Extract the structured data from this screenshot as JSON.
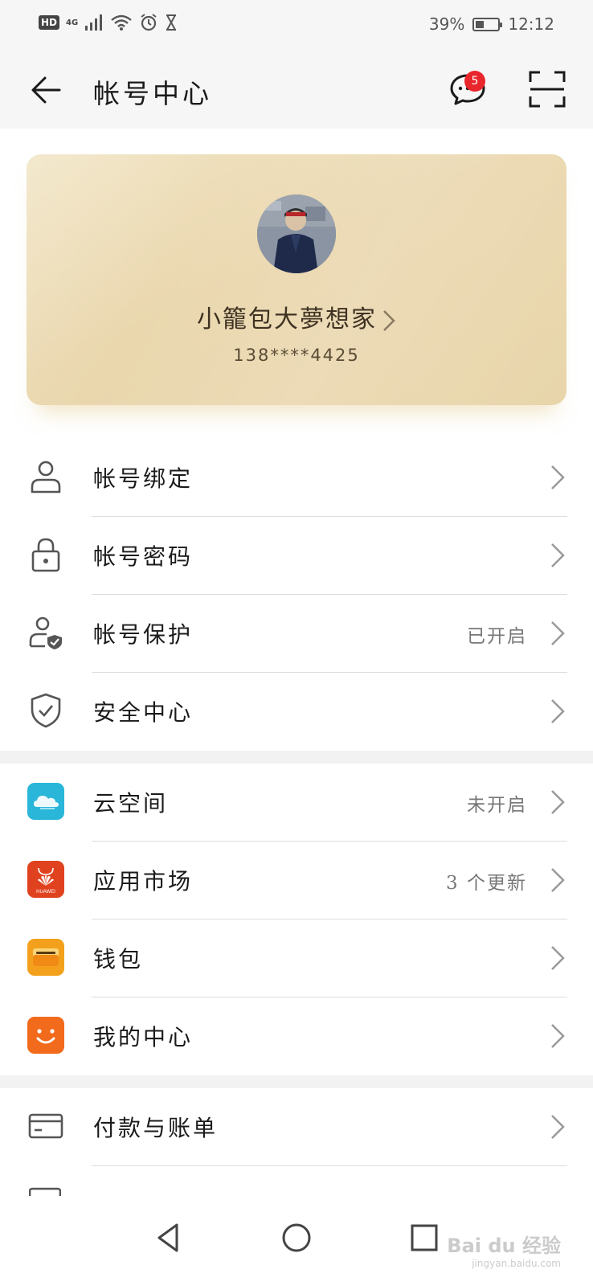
{
  "status_bar": {
    "hd": "HD",
    "network": "4G",
    "battery_percent": "39%",
    "battery_level": 0.39,
    "time": "12:12",
    "icons": [
      "signal-icon",
      "wifi-icon",
      "alarm-icon",
      "hourglass-icon"
    ]
  },
  "header": {
    "title": "帐号中心",
    "back_icon": "arrow-left-icon",
    "message_badge": "5",
    "scan_icon": "scan-icon"
  },
  "profile": {
    "name": "小籠包大夢想家",
    "phone": "138****4425"
  },
  "sections": [
    {
      "items": [
        {
          "label": "帐号绑定",
          "value": "",
          "icon": "person-icon"
        },
        {
          "label": "帐号密码",
          "value": "",
          "icon": "lock-icon"
        },
        {
          "label": "帐号保护",
          "value": "已开启",
          "icon": "person-shield-icon"
        },
        {
          "label": "安全中心",
          "value": "",
          "icon": "shield-check-icon"
        }
      ]
    },
    {
      "items": [
        {
          "label": "云空间",
          "value": "未开启",
          "icon": "cloud-icon",
          "color": "#29b6d9"
        },
        {
          "label": "应用市场",
          "value": "3 个更新",
          "icon": "huawei-appgallery-icon",
          "color": "#e0421f",
          "icon_text": "HUAWEI"
        },
        {
          "label": "钱包",
          "value": "",
          "icon": "wallet-icon",
          "color": "#f3a11c"
        },
        {
          "label": "我的中心",
          "value": "",
          "icon": "smile-icon",
          "color": "#f26a1b"
        }
      ]
    },
    {
      "items": [
        {
          "label": "付款与账单",
          "value": "",
          "icon": "card-icon"
        }
      ]
    }
  ],
  "watermark": {
    "text": "Bai du 经验",
    "sub": "jingyan.baidu.com"
  },
  "colors": {
    "card_gold": "#ead7ae",
    "badge_red": "#e8262c",
    "divider": "#dcdcdc"
  }
}
